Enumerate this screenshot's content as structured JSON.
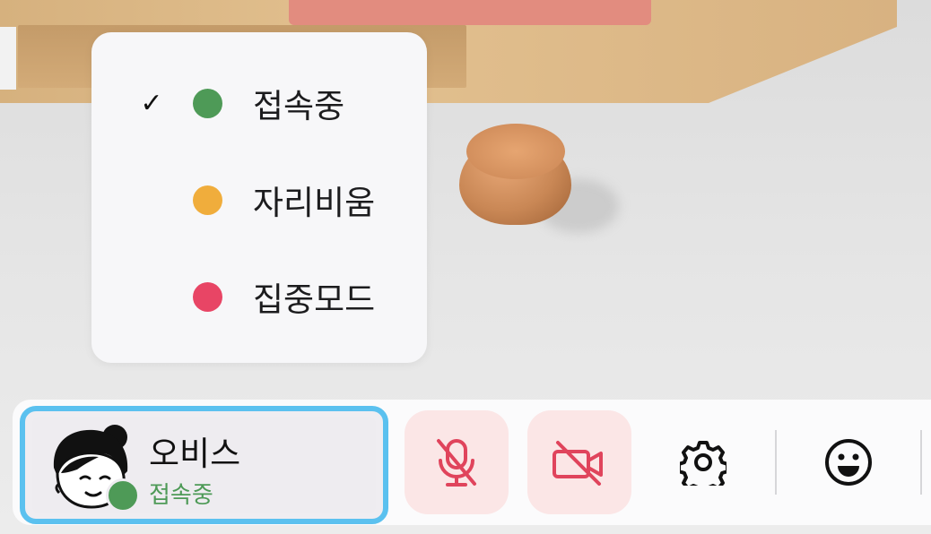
{
  "status_menu": {
    "options": [
      {
        "label": "접속중",
        "color": "#4e9a57",
        "selected": true,
        "check_icon": "checkmark-icon"
      },
      {
        "label": "자리비움",
        "color": "#f0ad3c",
        "selected": false
      },
      {
        "label": "집중모드",
        "color": "#e84565",
        "selected": false
      }
    ]
  },
  "profile": {
    "name": "오비스",
    "status": "접속중",
    "status_color": "#4e9a57",
    "highlight_color": "#5bc1ef"
  },
  "toolbar": {
    "mic_icon": "mic-off-icon",
    "camera_icon": "camera-off-icon",
    "settings_icon": "gear-icon",
    "emoji_icon": "smiley-icon",
    "off_color": "#e0445c"
  },
  "checkmark_glyph": "✓"
}
